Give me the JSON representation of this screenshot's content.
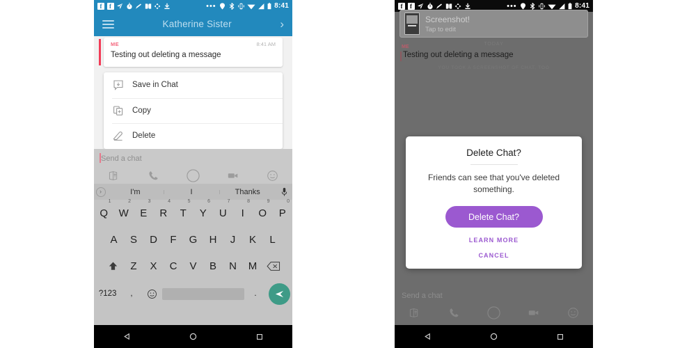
{
  "statusbar": {
    "time": "8:41",
    "left_icons": [
      "facebook-icon",
      "facebook-icon",
      "paper-plane-icon",
      "timer-icon",
      "pencil-icon",
      "book-icon",
      "sync-icon",
      "download-icon"
    ],
    "right_icons": [
      "more-icon",
      "location-icon",
      "bluetooth-icon",
      "vibrate-icon",
      "wifi-icon",
      "signal-icon",
      "battery-icon"
    ],
    "colors": {
      "blue": "#2289bd",
      "dark": "#0b0b0b"
    }
  },
  "left_phone": {
    "header": {
      "menu_icon": "hamburger-icon",
      "title": "Katherine Sister",
      "chevron": "›"
    },
    "message": {
      "sender": "ME",
      "time": "8:41 AM",
      "text": "Testing out deleting a message"
    },
    "context_menu": [
      {
        "icon": "save-in-chat-icon",
        "label": "Save in Chat"
      },
      {
        "icon": "copy-icon",
        "label": "Copy"
      },
      {
        "icon": "delete-eraser-icon",
        "label": "Delete"
      }
    ],
    "composer": {
      "placeholder": "Send a chat",
      "tools": [
        "sticker-icon",
        "phone-call-icon",
        "camera-circle-icon",
        "video-camera-icon",
        "emoji-icon"
      ]
    },
    "keyboard": {
      "suggestions": [
        "I'm",
        "I",
        "Thanks"
      ],
      "expand_icon": "chevron-right-icon",
      "mic_icon": "microphone-icon",
      "row1": [
        {
          "k": "Q",
          "n": "1"
        },
        {
          "k": "W",
          "n": "2"
        },
        {
          "k": "E",
          "n": "3"
        },
        {
          "k": "R",
          "n": "4"
        },
        {
          "k": "T",
          "n": "5"
        },
        {
          "k": "Y",
          "n": "6"
        },
        {
          "k": "U",
          "n": "7"
        },
        {
          "k": "I",
          "n": "8"
        },
        {
          "k": "O",
          "n": "9"
        },
        {
          "k": "P",
          "n": "0"
        }
      ],
      "row2": [
        "A",
        "S",
        "D",
        "F",
        "G",
        "H",
        "J",
        "K",
        "L"
      ],
      "row3": [
        "Z",
        "X",
        "C",
        "V",
        "B",
        "N",
        "M"
      ],
      "shift_icon": "shift-up-icon",
      "backspace_icon": "backspace-icon",
      "symbols_key": "?123",
      "comma_key": ",",
      "emoji_key": "emoji-icon",
      "period_key": ".",
      "send_icon": "send-paper-plane-icon",
      "send_color": "#3e9b87"
    }
  },
  "right_phone": {
    "screenshot_banner": {
      "title": "Screenshot!",
      "subtitle": "Tap to edit",
      "thumb": "screenshot-thumbnail"
    },
    "date_divider": "TODAY",
    "message": {
      "sender": "ME",
      "text": "Testing out deleting a message"
    },
    "screenshot_note": "YOU TOOK A SCREENSHOT OF CHAT, TOO",
    "dialog": {
      "title": "Delete Chat?",
      "body": "Friends can see that you've deleted something.",
      "primary_button": "Delete Chat?",
      "learn_more": "LEARN MORE",
      "cancel": "CANCEL",
      "accent": "#9b59d0"
    },
    "composer": {
      "placeholder": "Send a chat"
    }
  },
  "system_nav": {
    "back": "back-triangle-icon",
    "home": "home-circle-icon",
    "recents": "recents-square-icon"
  }
}
